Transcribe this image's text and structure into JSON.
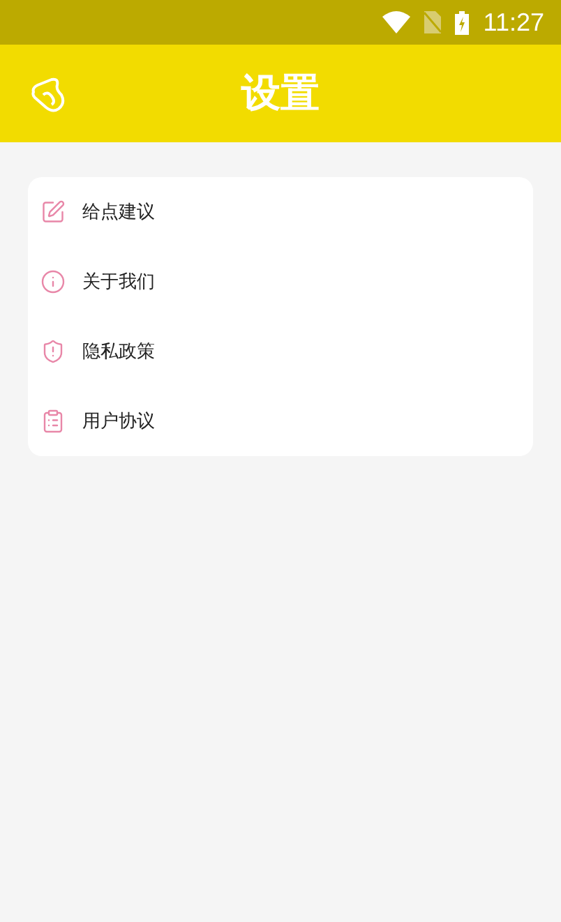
{
  "status_bar": {
    "time": "11:27"
  },
  "header": {
    "title": "设置"
  },
  "menu": [
    {
      "kind": "feedback",
      "label": "给点建议"
    },
    {
      "kind": "about",
      "label": "关于我们"
    },
    {
      "kind": "privacy",
      "label": "隐私政策"
    },
    {
      "kind": "agreement",
      "label": "用户协议"
    }
  ]
}
